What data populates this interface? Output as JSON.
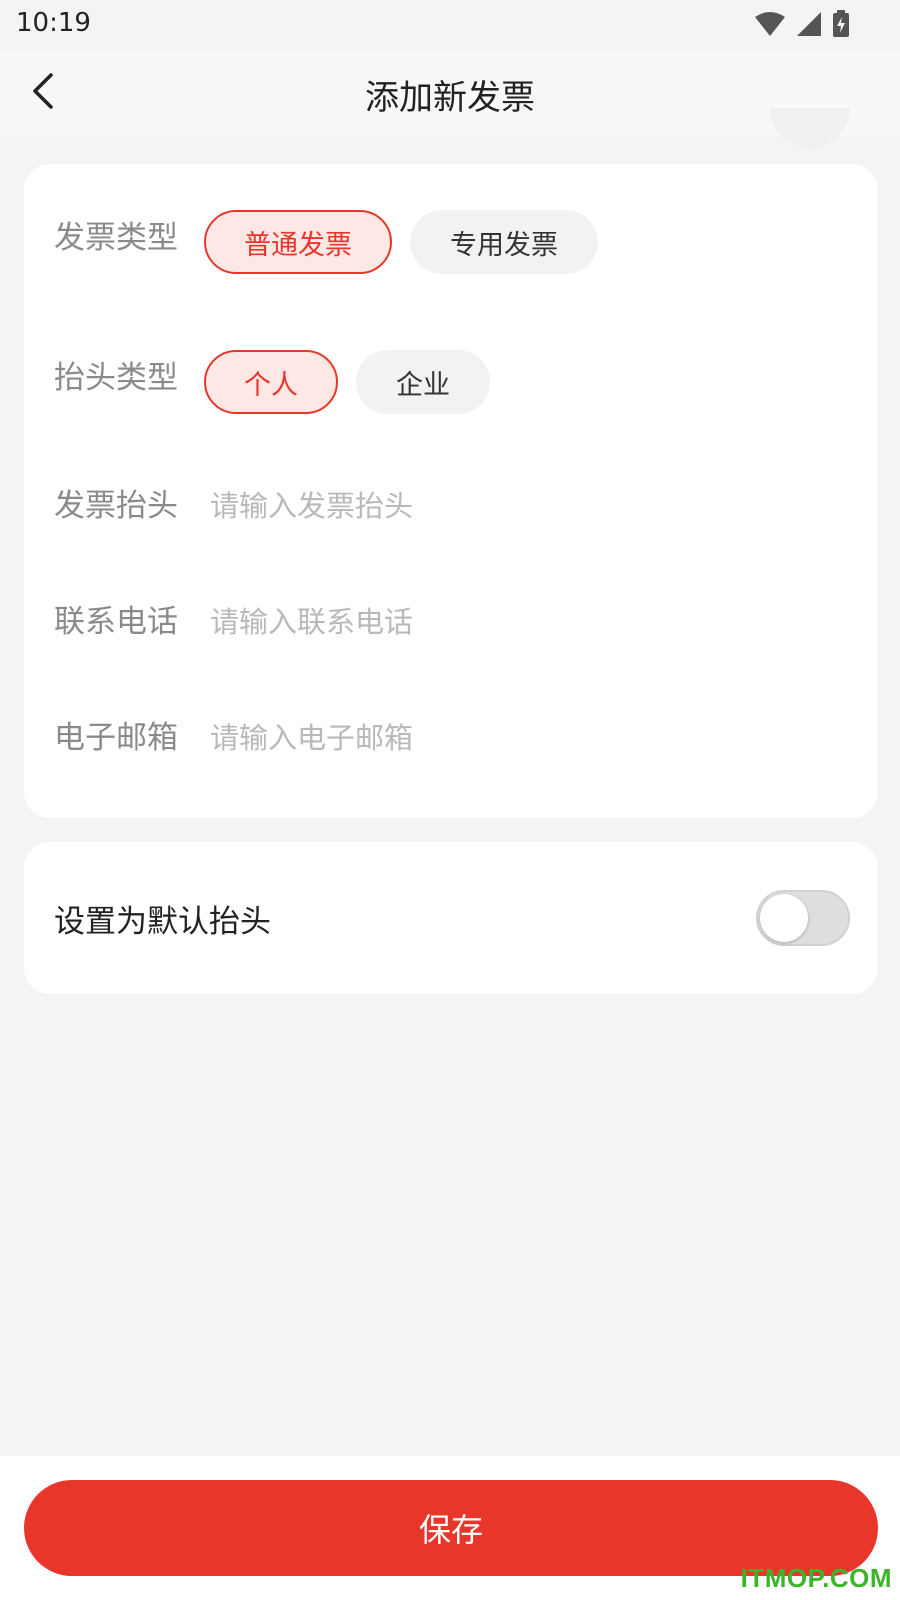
{
  "status_bar": {
    "time": "10:19"
  },
  "header": {
    "title": "添加新发票",
    "back_icon": "chevron-left-icon"
  },
  "form": {
    "invoice_type": {
      "label": "发票类型",
      "options": [
        "普通发票",
        "专用发票"
      ],
      "selected": "普通发票"
    },
    "title_type": {
      "label": "抬头类型",
      "options": [
        "个人",
        "企业"
      ],
      "selected": "个人"
    },
    "invoice_title": {
      "label": "发票抬头",
      "placeholder": "请输入发票抬头",
      "value": ""
    },
    "phone": {
      "label": "联系电话",
      "placeholder": "请输入联系电话",
      "value": ""
    },
    "email": {
      "label": "电子邮箱",
      "placeholder": "请输入电子邮箱",
      "value": ""
    }
  },
  "default_setting": {
    "label": "设置为默认抬头",
    "enabled": false
  },
  "footer": {
    "save_label": "保存"
  },
  "watermark": "ITMOP.COM",
  "colors": {
    "accent": "#e8372a",
    "accent_light": "#fde8e6",
    "background": "#f4f4f4",
    "placeholder": "#b9b9b9",
    "label": "#8a8a8a",
    "watermark": "#3db52b"
  }
}
